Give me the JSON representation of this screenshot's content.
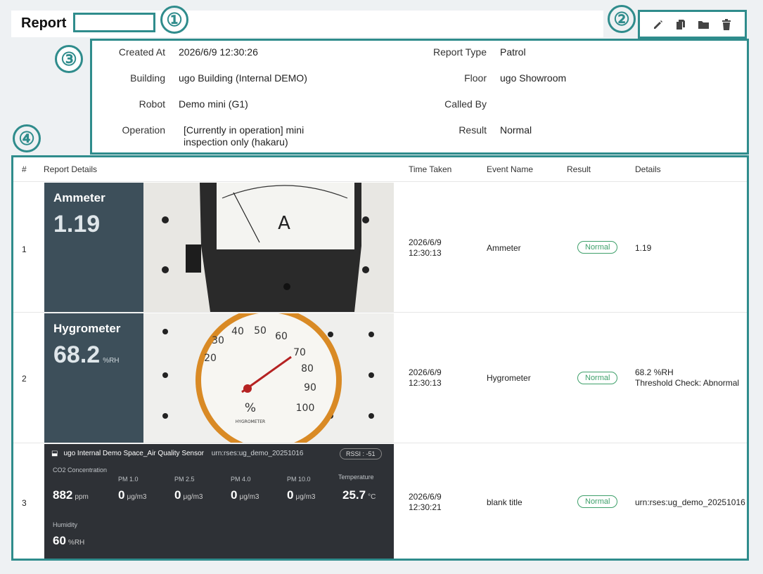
{
  "header": {
    "title": "Report",
    "title_input_value": ""
  },
  "callouts": [
    "①",
    "②",
    "③",
    "④"
  ],
  "toolbar": {
    "items": [
      "pencil-icon",
      "copy-icon",
      "folder-icon",
      "trash-icon"
    ]
  },
  "meta": {
    "created_at_label": "Created At",
    "created_at": "2026/6/9 12:30:26",
    "report_type_label": "Report Type",
    "report_type": "Patrol",
    "building_label": "Building",
    "building": "ugo Building (Internal DEMO)",
    "floor_label": "Floor",
    "floor": "ugo Showroom",
    "robot_label": "Robot",
    "robot": "Demo mini (G1)",
    "called_by_label": "Called By",
    "called_by": "",
    "operation_label": "Operation",
    "operation": "[Currently in operation] mini inspection only (hakaru)",
    "result_label": "Result",
    "result": "Normal"
  },
  "table": {
    "headers": [
      "#",
      "Report Details",
      "Time Taken",
      "Event Name",
      "Result",
      "Details"
    ],
    "rows": [
      {
        "num": "1",
        "panel_title": "Ammeter",
        "panel_value": "1.19",
        "panel_unit": "",
        "time_a": "2026/6/9",
        "time_b": "12:30:13",
        "event": "Ammeter",
        "result": "Normal",
        "details_a": "1.19",
        "details_b": ""
      },
      {
        "num": "2",
        "panel_title": "Hygrometer",
        "panel_value": "68.2",
        "panel_unit": "%RH",
        "time_a": "2026/6/9",
        "time_b": "12:30:13",
        "event": "Hygrometer",
        "result": "Normal",
        "details_a": "68.2 %RH",
        "details_b": "Threshold Check: Abnormal"
      },
      {
        "num": "3",
        "time_a": "2026/6/9",
        "time_b": "12:30:21",
        "event": "blank title",
        "result": "Normal",
        "details_a": "urn:rses:ug_demo_20251016",
        "details_b": ""
      }
    ],
    "photo_labels": {
      "ammeter_dial": "A",
      "hygrometer_percent": "%",
      "hygrometer_brand": "HYGROMETER"
    },
    "dial_numbers": [
      "20",
      "30",
      "40",
      "50",
      "60",
      "70",
      "80",
      "90",
      "100"
    ]
  },
  "sensor": {
    "title": "ugo Internal Demo Space_Air Quality Sensor",
    "urn": "urn:rses:ug_demo_20251016",
    "rssi": "RSSI : -51",
    "readings": [
      {
        "label": "CO2 Concentration",
        "value": "882",
        "unit": "ppm"
      },
      {
        "label": "PM 1.0",
        "value": "0",
        "unit": "μg/m3"
      },
      {
        "label": "PM 2.5",
        "value": "0",
        "unit": "μg/m3"
      },
      {
        "label": "PM 4.0",
        "value": "0",
        "unit": "μg/m3"
      },
      {
        "label": "PM 10.0",
        "value": "0",
        "unit": "μg/m3"
      },
      {
        "label": "Temperature",
        "value": "25.7",
        "unit": "°C"
      },
      {
        "label": "Humidity",
        "value": "60",
        "unit": "%RH"
      }
    ]
  },
  "colors": {
    "accent": "#2f8c8c",
    "normal": "#3ea06a",
    "panel": "#3d4f5a",
    "sensor_bg": "#2e3136"
  }
}
